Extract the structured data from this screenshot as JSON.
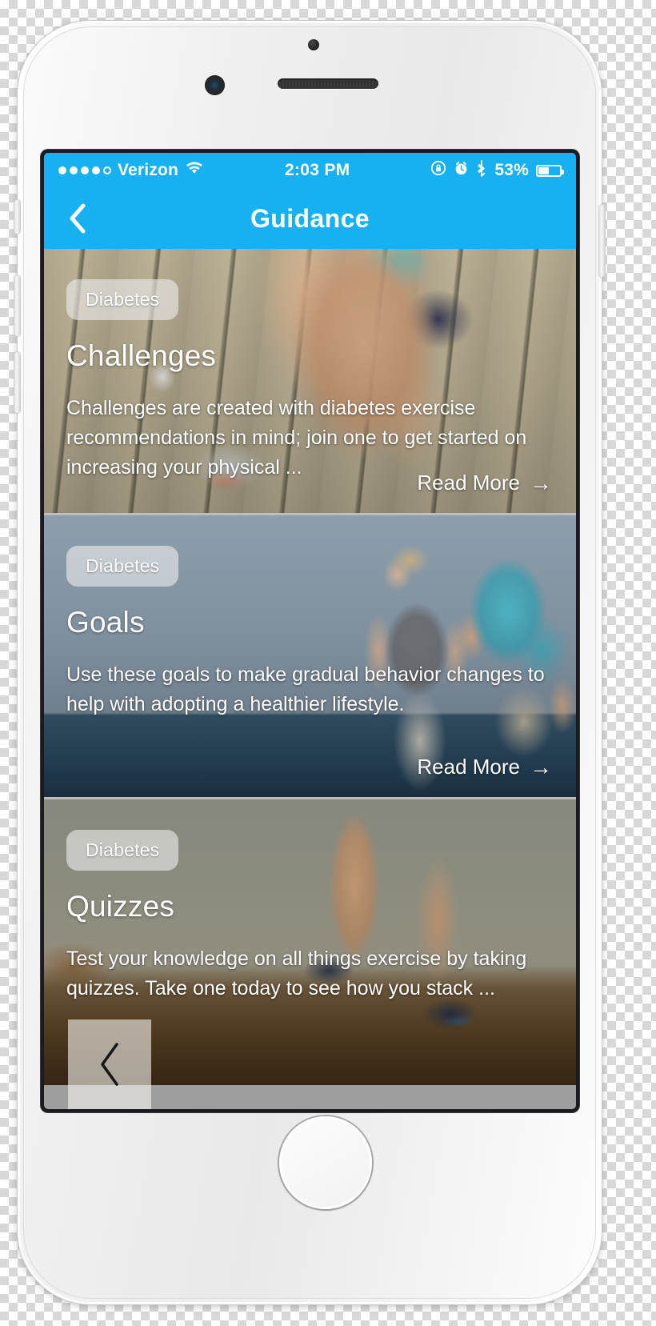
{
  "device": {
    "label": "iphone-mockup",
    "hardware": {
      "front_camera": "camera-icon",
      "earpiece": "speaker-grille",
      "proximity_sensor": "proximity-sensor-dot",
      "home_button": "home-button"
    }
  },
  "status_bar": {
    "signal_dots_filled": 4,
    "signal_dots_total": 5,
    "carrier": "Verizon",
    "wifi_icon": "wifi-icon",
    "time": "2:03 PM",
    "rotation_lock_icon": "rotation-lock-icon",
    "alarm_icon": "alarm-clock-icon",
    "bluetooth_icon": "bluetooth-icon",
    "battery_percent": "53%",
    "battery_icon": "battery-icon",
    "battery_level": 53,
    "background_color": "#17b0f0",
    "text_color": "#ffffff"
  },
  "nav_bar": {
    "back_icon": "chevron-left-icon",
    "title": "Guidance",
    "background_color": "#17b0f0"
  },
  "cards": [
    {
      "tag": "Diabetes",
      "title": "Challenges",
      "description": "Challenges are created with diabetes exercise recommendations in mind; join one to get started on increasing your physical ...",
      "read_more": "Read More",
      "read_more_arrow": "→",
      "image_alt": "runner-tying-shoe-on-boardwalk"
    },
    {
      "tag": "Diabetes",
      "title": "Goals",
      "description": "Use these goals to make gradual behavior changes to help with adopting a healthier lifestyle.",
      "read_more": "Read More",
      "read_more_arrow": "→",
      "image_alt": "couple-jogging-by-the-sea"
    },
    {
      "tag": "Diabetes",
      "title": "Quizzes",
      "description": "Test your knowledge on all things exercise by taking quizzes. Take one today to see how you stack ...",
      "read_more": "",
      "read_more_arrow": "",
      "image_alt": "trail-runner-overcast-sky"
    }
  ],
  "overlay": {
    "prev_icon": "chevron-left-icon"
  },
  "colors": {
    "accent": "#17b0f0",
    "card_divider": "#bdbdbd",
    "text_on_image": "#ffffff",
    "tag_background": "rgba(235,235,235,0.62)"
  }
}
